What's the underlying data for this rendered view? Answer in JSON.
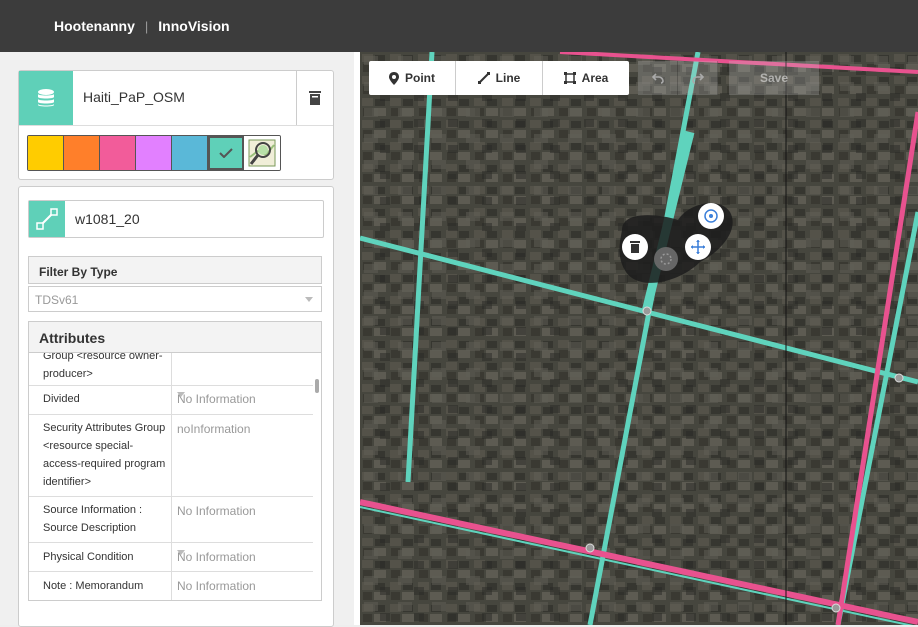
{
  "header": {
    "brand": "Hootenanny",
    "separator": "|",
    "project": "InnoVision"
  },
  "layer": {
    "name": "Haiti_PaP_OSM",
    "swatches": [
      "#ffcc00",
      "#ff7f2a",
      "#f25c9a",
      "#e280ff",
      "#5ab8d8",
      "#5fd0b8"
    ],
    "selected_swatch": 5
  },
  "feature": {
    "id": "w1081_20"
  },
  "filter": {
    "label": "Filter By Type",
    "schema": "TDSv61"
  },
  "attributes": {
    "title": "Attributes",
    "rows": [
      {
        "label": "Group <resource owner-producer>",
        "value": ""
      },
      {
        "label": "Divided",
        "value": "No Information"
      },
      {
        "label": "Security Attributes Group <resource special-access-required program identifier>",
        "value": "noInformation"
      },
      {
        "label": "Source Information : Source Description",
        "value": "No Information"
      },
      {
        "label": "Physical Condition",
        "value": "No Information"
      },
      {
        "label": "Note : Memorandum",
        "value": "No Information"
      }
    ]
  },
  "toolbar": {
    "point": "Point",
    "line": "Line",
    "area": "Area",
    "save": "Save"
  },
  "colors": {
    "accent": "#5fd0b8",
    "road_teal": "#5fd3bd",
    "road_pink": "#e8528f"
  }
}
